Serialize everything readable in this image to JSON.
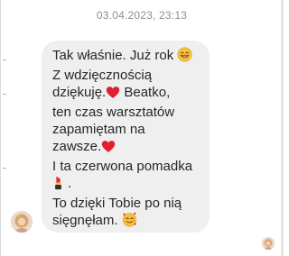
{
  "conversation": {
    "timestamp": "03.04.2023, 23:13"
  },
  "message": {
    "lines": {
      "l1": "Tak właśnie. Już rok",
      "l2": "Z wdzięcznością",
      "l3a": "dziękuję.",
      "l3b": " Beatko,",
      "l4": "ten czas warsztatów",
      "l5": "zapamiętam na",
      "l6": "zawsze.",
      "l7": "I ta czerwona pomadka",
      "l8": " .",
      "l9": "To dzięki Tobie po nią",
      "l10": "sięgnęłam. "
    },
    "emojis": [
      "grinning-face-with-smiling-eyes",
      "red-heart",
      "red-heart",
      "lipstick",
      "smiling-face-with-hearts"
    ]
  },
  "colors": {
    "bubble": "#efefef",
    "text": "#262626",
    "timestamp": "#8e8e8e",
    "heart": "#e0202f"
  }
}
